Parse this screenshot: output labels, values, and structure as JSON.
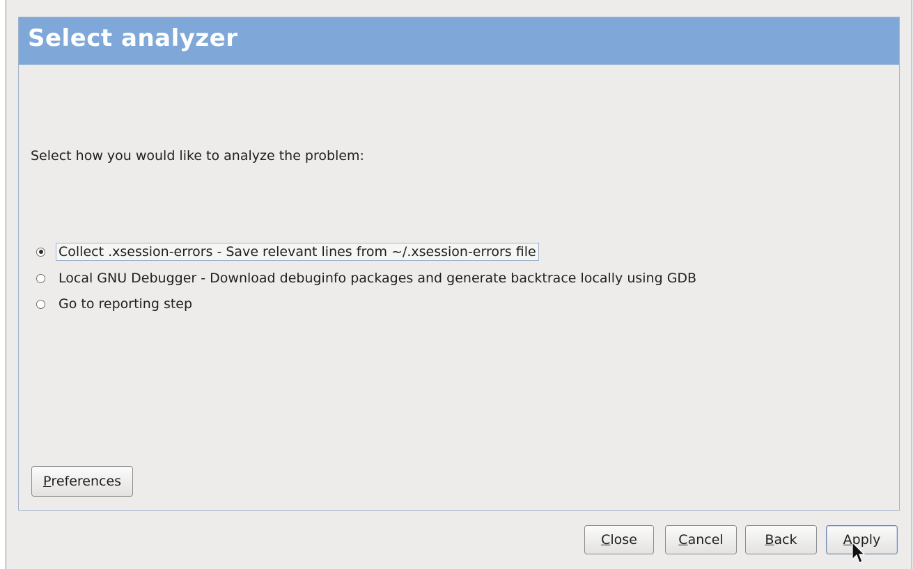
{
  "dialog": {
    "title": "Select analyzer",
    "prompt": "Select how you would like to analyze the problem:",
    "options": [
      {
        "label": "Collect .xsession-errors - Save relevant lines from ~/.xsession-errors file",
        "selected": true
      },
      {
        "label": "Local GNU Debugger - Download debuginfo packages and generate backtrace locally using GDB",
        "selected": false
      },
      {
        "label": "Go to reporting step",
        "selected": false
      }
    ],
    "preferences_button": {
      "mnemonic": "P",
      "rest": "references"
    }
  },
  "footer": {
    "close": {
      "mnemonic": "C",
      "rest": "lose"
    },
    "cancel": {
      "mnemonic": "C",
      "rest": "ancel"
    },
    "back": {
      "mnemonic": "B",
      "rest": "ack"
    },
    "apply": {
      "mnemonic": "A",
      "rest": "pply"
    }
  },
  "colors": {
    "header_bg": "#7fa8d9",
    "window_bg": "#edeceb",
    "frame_border": "#9fb3cc"
  },
  "icons": {
    "cursor": "mouse-pointer-icon"
  }
}
